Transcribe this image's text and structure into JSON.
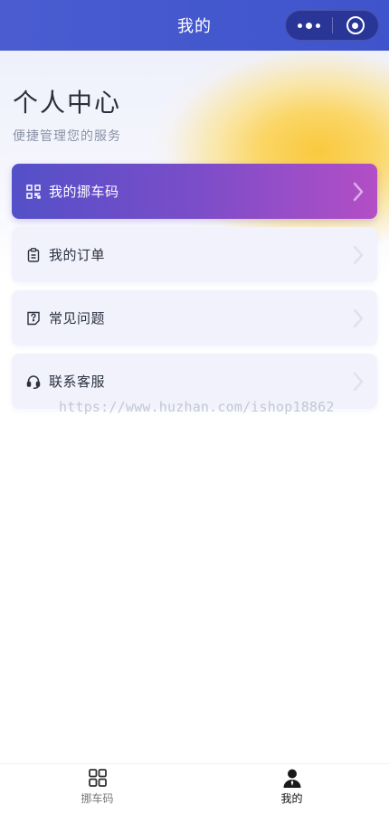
{
  "navbar": {
    "title": "我的",
    "capsule": {
      "more_icon": "more-dots-icon",
      "close_icon": "target-ring-icon"
    }
  },
  "hero": {
    "title": "个人中心",
    "subtitle": "便捷管理您的服务"
  },
  "menu": {
    "items": [
      {
        "label": "我的挪车码",
        "icon": "qr-code-icon"
      },
      {
        "label": "我的订单",
        "icon": "clipboard-icon"
      },
      {
        "label": "常见问题",
        "icon": "question-note-icon"
      },
      {
        "label": "联系客服",
        "icon": "headset-icon"
      }
    ]
  },
  "watermark": "https://www.huzhan.com/ishop18862",
  "tabbar": {
    "tabs": [
      {
        "label": "挪车码",
        "icon": "grid-icon",
        "active": false
      },
      {
        "label": "我的",
        "icon": "user-icon",
        "active": true
      }
    ]
  },
  "colors": {
    "nav_bg": "#4a5cd0",
    "primary_gradient_start": "#5350c8",
    "primary_gradient_end": "#b34ec6",
    "glow": "#f9c93e"
  }
}
